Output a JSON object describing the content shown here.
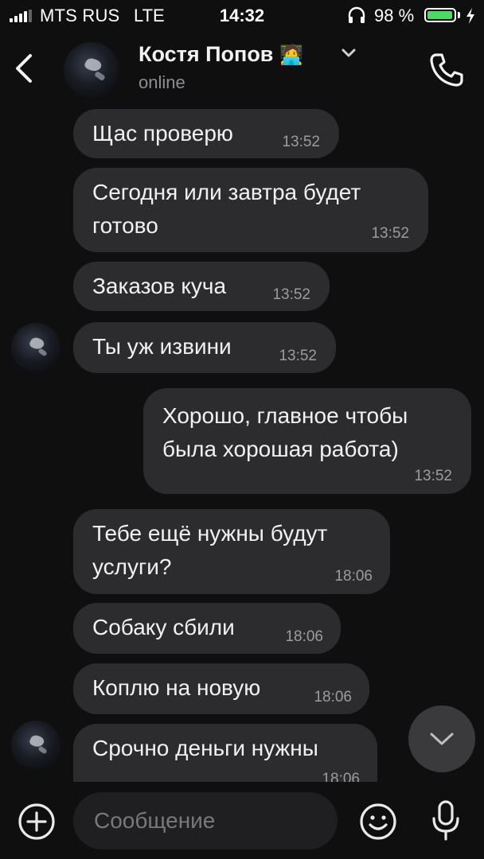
{
  "status_bar": {
    "carrier": "MTS RUS",
    "network": "LTE",
    "time": "14:32",
    "battery_percent": "98 %",
    "battery_level": 0.98
  },
  "header": {
    "contact_name": "Костя Попов",
    "contact_emoji": "🧑‍💻",
    "status": "online",
    "icons": [
      "back-chevron-icon",
      "dropdown-chevron-icon",
      "phone-icon"
    ]
  },
  "messages": [
    {
      "direction": "in",
      "text": "Щас проверю",
      "time": "13:52"
    },
    {
      "direction": "in",
      "text": "Сегодня или завтра будет\nготово",
      "time": "13:52"
    },
    {
      "direction": "in",
      "text": "Заказов куча",
      "time": "13:52"
    },
    {
      "direction": "in",
      "text": "Ты уж извини",
      "time": "13:52"
    },
    {
      "direction": "out",
      "text": "Хорошо, главное чтобы\nбыла хорошая работа)",
      "time": "13:52"
    },
    {
      "direction": "in",
      "text": "Тебе ещё нужны будут\nуслуги?",
      "time": "18:06"
    },
    {
      "direction": "in",
      "text": "Собаку сбили",
      "time": "18:06"
    },
    {
      "direction": "in",
      "text": "Коплю на новую",
      "time": "18:06"
    },
    {
      "direction": "in",
      "text": "Срочно деньги нужны",
      "time": "18:06"
    }
  ],
  "input": {
    "placeholder": "Сообщение",
    "value": ""
  },
  "colors": {
    "background": "#0f0f10",
    "bubble": "#2c2c2e",
    "battery_fill": "#4cd964"
  }
}
